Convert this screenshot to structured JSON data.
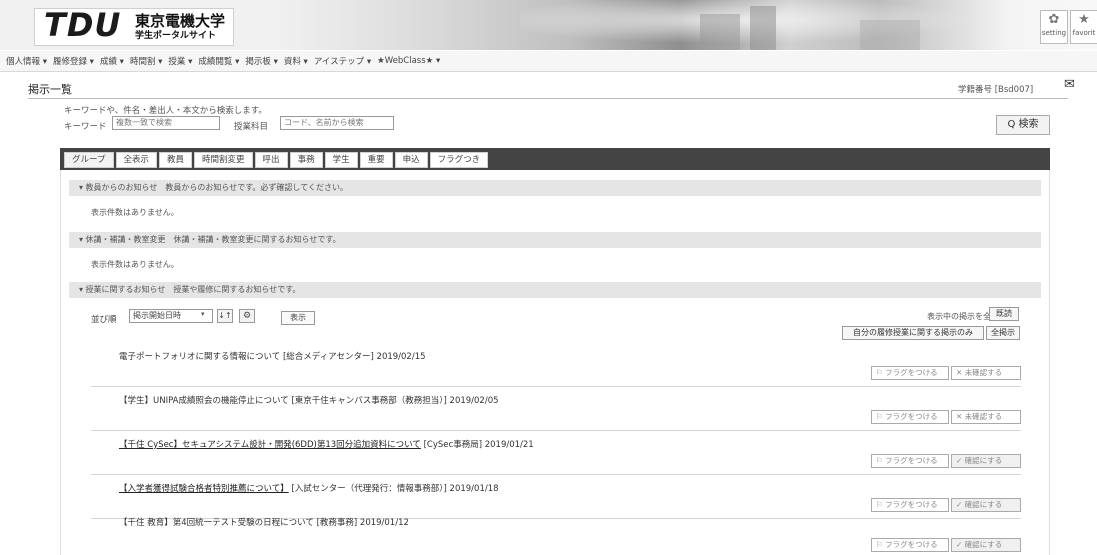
{
  "header": {
    "logo_text": "TDU",
    "logo_jp_main": "東京電機大学",
    "logo_jp_sub": "学生ポータルサイト",
    "setting_label": "setting",
    "favorite_label": "favorit"
  },
  "menu": {
    "items": [
      "個人情報 ▾",
      "履修登録 ▾",
      "成績 ▾",
      "時間割 ▾",
      "授業 ▾",
      "成績閲覧 ▾",
      "掲示板 ▾",
      "資料 ▾",
      "アイステップ ▾",
      "★WebClass★ ▾"
    ]
  },
  "page": {
    "title": "掲示一覧",
    "user": "学籍番号 [Bsd007]"
  },
  "search": {
    "description": "キーワードや、件名・差出人・本文から検索します。",
    "keyword_label": "キーワード",
    "keyword_placeholder": "複数一致で検索",
    "course_label": "授業科目",
    "course_placeholder": "コード、名前から検索",
    "button_label": "Q 検索"
  },
  "tabs": [
    "グループ",
    "全表示",
    "教員",
    "時間割変更",
    "呼出",
    "事務",
    "学生",
    "重要",
    "申込",
    "フラグつき"
  ],
  "sections": [
    {
      "header": "▾ 教員からのお知らせ　教員からのお知らせです。必ず確認してください。",
      "empty": "表示件数はありません。"
    },
    {
      "header": "▾ 休講・補講・教室変更　休講・補講・教室変更に関するお知らせです。",
      "empty": "表示件数はありません。"
    },
    {
      "header": "▾ 授業に関するお知らせ　授業や履修に関するお知らせです。"
    }
  ],
  "controls": {
    "sort_label": "並び順",
    "sort_value": "掲示開始日時",
    "sort_dir": "↓↑",
    "gear": "⚙",
    "show_button": "表示",
    "bulk_label": "表示中の掲示を全て",
    "bulk_button": "既読",
    "filter_button": "自分の履修授業に関する掲示のみ",
    "all_button": "全掲示"
  },
  "notices": [
    {
      "title": "電子ポートフォリオに関する情報について",
      "sender": "[総合メディアセンター]",
      "date": "2019/02/15",
      "flag": "⚐ フラグをつける",
      "check": "✕ 未確認する",
      "done": false,
      "link": false
    },
    {
      "title": "【学生】UNIPA成績照会の機能停止について",
      "sender": "[東京千住キャンパス事務部（教務担当）]",
      "date": "2019/02/05",
      "flag": "⚐ フラグをつける",
      "check": "✕ 未確認する",
      "done": false,
      "link": false
    },
    {
      "title": "【千住 CySec】セキュアシステム設計・開発(6DD)第13回分追加資料について",
      "sender": "[CySec事務局]",
      "date": "2019/01/21",
      "flag": "⚐ フラグをつける",
      "check": "✓ 確認にする",
      "done": true,
      "link": true
    },
    {
      "title": "【入学者獲得試験合格者特別推薦について】",
      "sender": "[入試センター（代理発行：情報事務部）]",
      "date": "2019/01/18",
      "flag": "⚐ フラグをつける",
      "check": "✓ 確認にする",
      "done": true,
      "link": true
    },
    {
      "title": "【千住 教育】第4回統一テスト受験の日程について",
      "sender": "[教務事務]",
      "date": "2019/01/12",
      "flag": "⚐ フラグをつける",
      "check": "✓ 確認にする",
      "done": true,
      "link": false
    }
  ],
  "colors": {
    "tabbar": "#444444",
    "section_header": "#e5e5e5"
  }
}
